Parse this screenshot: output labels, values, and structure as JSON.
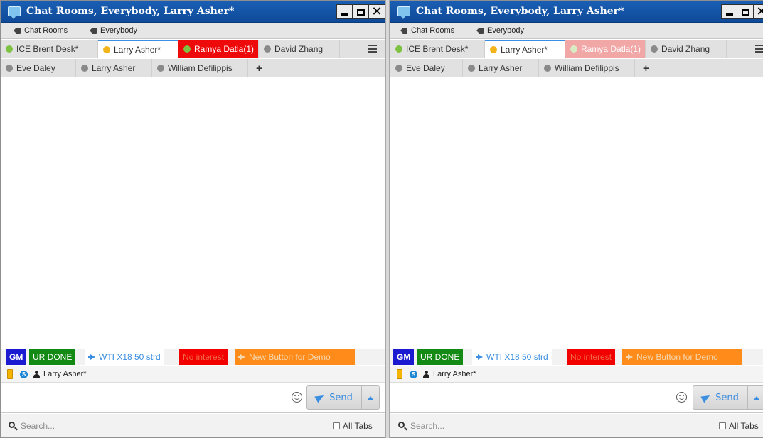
{
  "windows": [
    {
      "title": "Chat Rooms, Everybody, Larry Asher*",
      "room_tabs": [
        "Chat Rooms",
        "Everybody"
      ],
      "tabs_row1": [
        {
          "label": "ICE Brent Desk*",
          "dot_color": "#7dc242",
          "state": "normal"
        },
        {
          "label": "Larry Asher*",
          "dot_color": "#f3b41b",
          "state": "active"
        },
        {
          "label": "Ramya Datla(1)",
          "dot_color": "#7dc242",
          "state": "alert"
        },
        {
          "label": "David Zhang",
          "dot_color": "#8a8a8a",
          "state": "normal"
        }
      ],
      "tabs_row2": [
        {
          "label": "Eve Daley",
          "dot_color": "#8a8a8a"
        },
        {
          "label": "Larry Asher",
          "dot_color": "#8a8a8a"
        },
        {
          "label": "William Defilippis",
          "dot_color": "#8a8a8a"
        }
      ],
      "add_tab_label": "+",
      "quick_buttons": [
        "GM",
        "UR DONE",
        "WTI X18 50 strd",
        "No interest",
        "New Button for Demo"
      ],
      "participant": "Larry Asher*",
      "send_label": "Send",
      "search_placeholder": "Search...",
      "all_tabs_label": "All Tabs"
    },
    {
      "title": "Chat Rooms, Everybody, Larry Asher*",
      "room_tabs": [
        "Chat Rooms",
        "Everybody"
      ],
      "tabs_row1": [
        {
          "label": "ICE Brent Desk*",
          "dot_color": "#7dc242",
          "state": "normal"
        },
        {
          "label": "Larry Asher*",
          "dot_color": "#f3b41b",
          "state": "active"
        },
        {
          "label": "Ramya Datla(1)",
          "dot_color": "#d8ecc4",
          "state": "alert-faded"
        },
        {
          "label": "David Zhang",
          "dot_color": "#8a8a8a",
          "state": "normal"
        }
      ],
      "tabs_row2": [
        {
          "label": "Eve Daley",
          "dot_color": "#8a8a8a"
        },
        {
          "label": "Larry Asher",
          "dot_color": "#8a8a8a"
        },
        {
          "label": "William Defilippis",
          "dot_color": "#8a8a8a"
        }
      ],
      "add_tab_label": "+",
      "quick_buttons": [
        "GM",
        "UR DONE",
        "WTI X18 50 strd",
        "No interest",
        "New Button for Demo"
      ],
      "participant": "Larry Asher*",
      "send_label": "Send",
      "search_placeholder": "Search...",
      "all_tabs_label": "All Tabs"
    }
  ],
  "colors": {
    "title_bar": "#1a5fb4",
    "alert_tab": "#ee0a0a",
    "alert_tab_faded": "#f2a7a7",
    "gm_button": "#1a1ad0",
    "urdone_button": "#138a13",
    "nointerest_button": "#f20000",
    "newbutton_button": "#ff8c1a",
    "accent": "#3b8ee0"
  },
  "icons": [
    "app-icon",
    "minimize-icon",
    "maximize-icon",
    "close-icon",
    "tag-icon",
    "status-dot-icon",
    "hamburger-menu-icon",
    "plus-icon",
    "megaphone-icon",
    "phone-icon",
    "skype-icon",
    "person-icon",
    "emoji-icon",
    "send-icon",
    "caret-up-icon",
    "search-icon",
    "checkbox-icon"
  ]
}
